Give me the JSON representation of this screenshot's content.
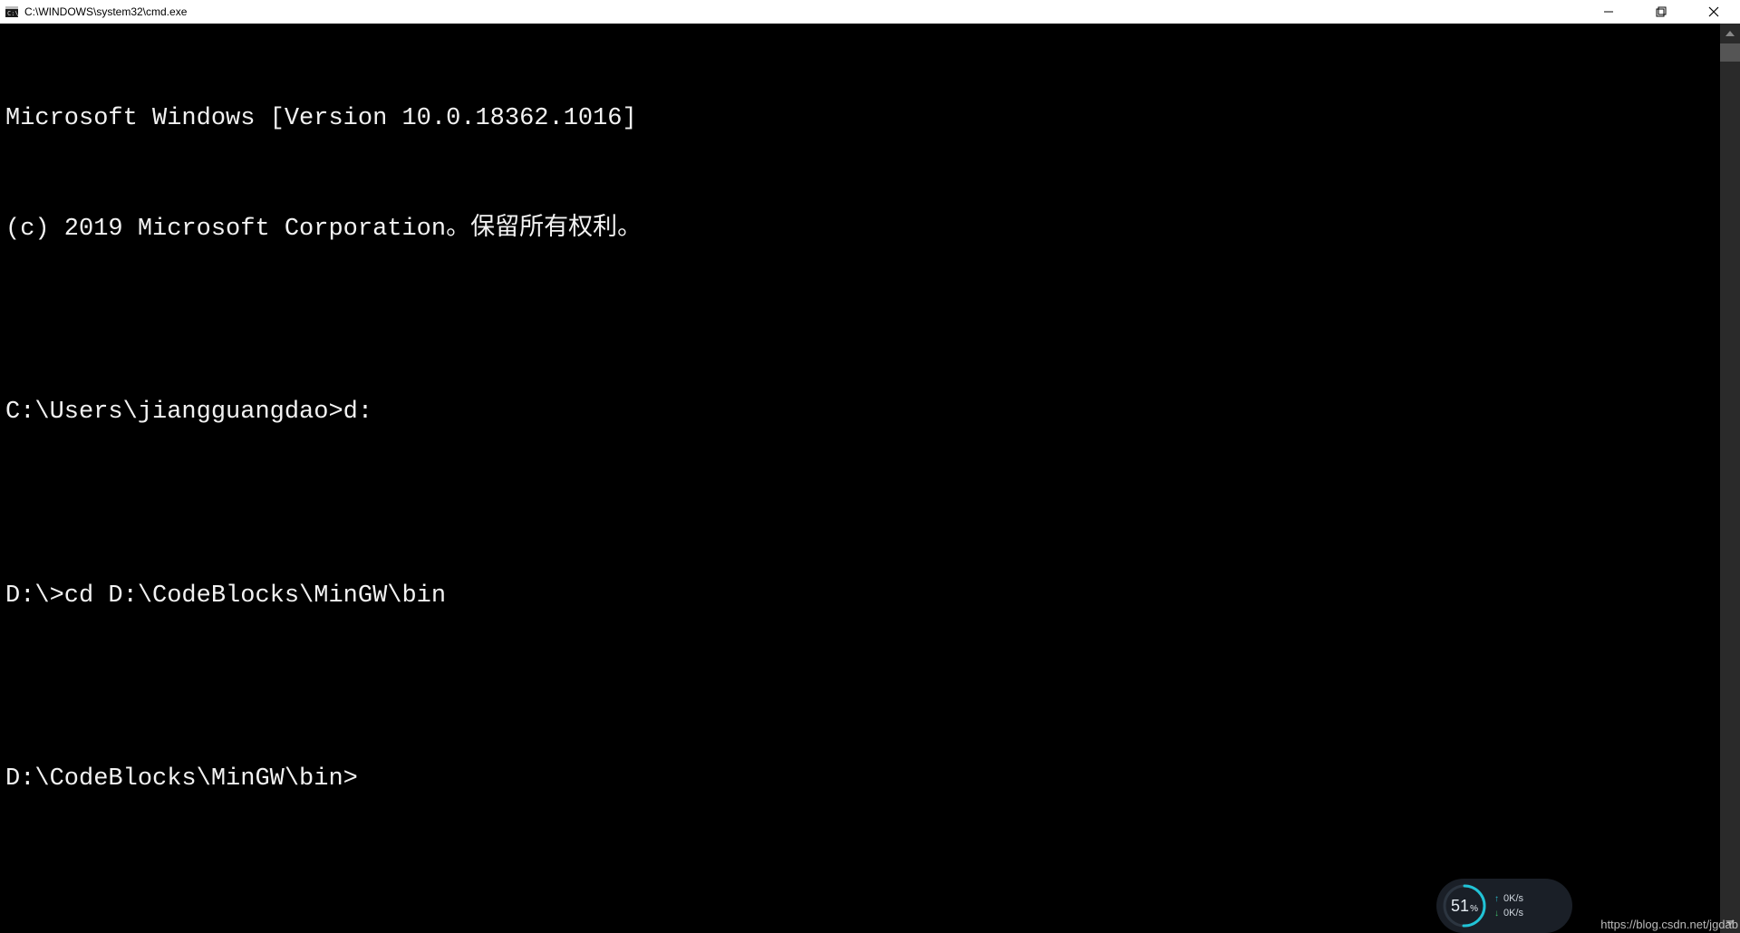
{
  "titlebar": {
    "title": "C:\\WINDOWS\\system32\\cmd.exe"
  },
  "terminal": {
    "lines": [
      "Microsoft Windows [Version 10.0.18362.1016]",
      "(c) 2019 Microsoft Corporation。保留所有权利。",
      "",
      "C:\\Users\\jiangguangdao>d:",
      "",
      "D:\\>cd D:\\CodeBlocks\\MinGW\\bin",
      "",
      "D:\\CodeBlocks\\MinGW\\bin>"
    ]
  },
  "widget": {
    "percent": "51",
    "percent_unit": "%",
    "upload": "0K/s",
    "download": "0K/s"
  },
  "watermark": "https://blog.csdn.net/jgdab"
}
